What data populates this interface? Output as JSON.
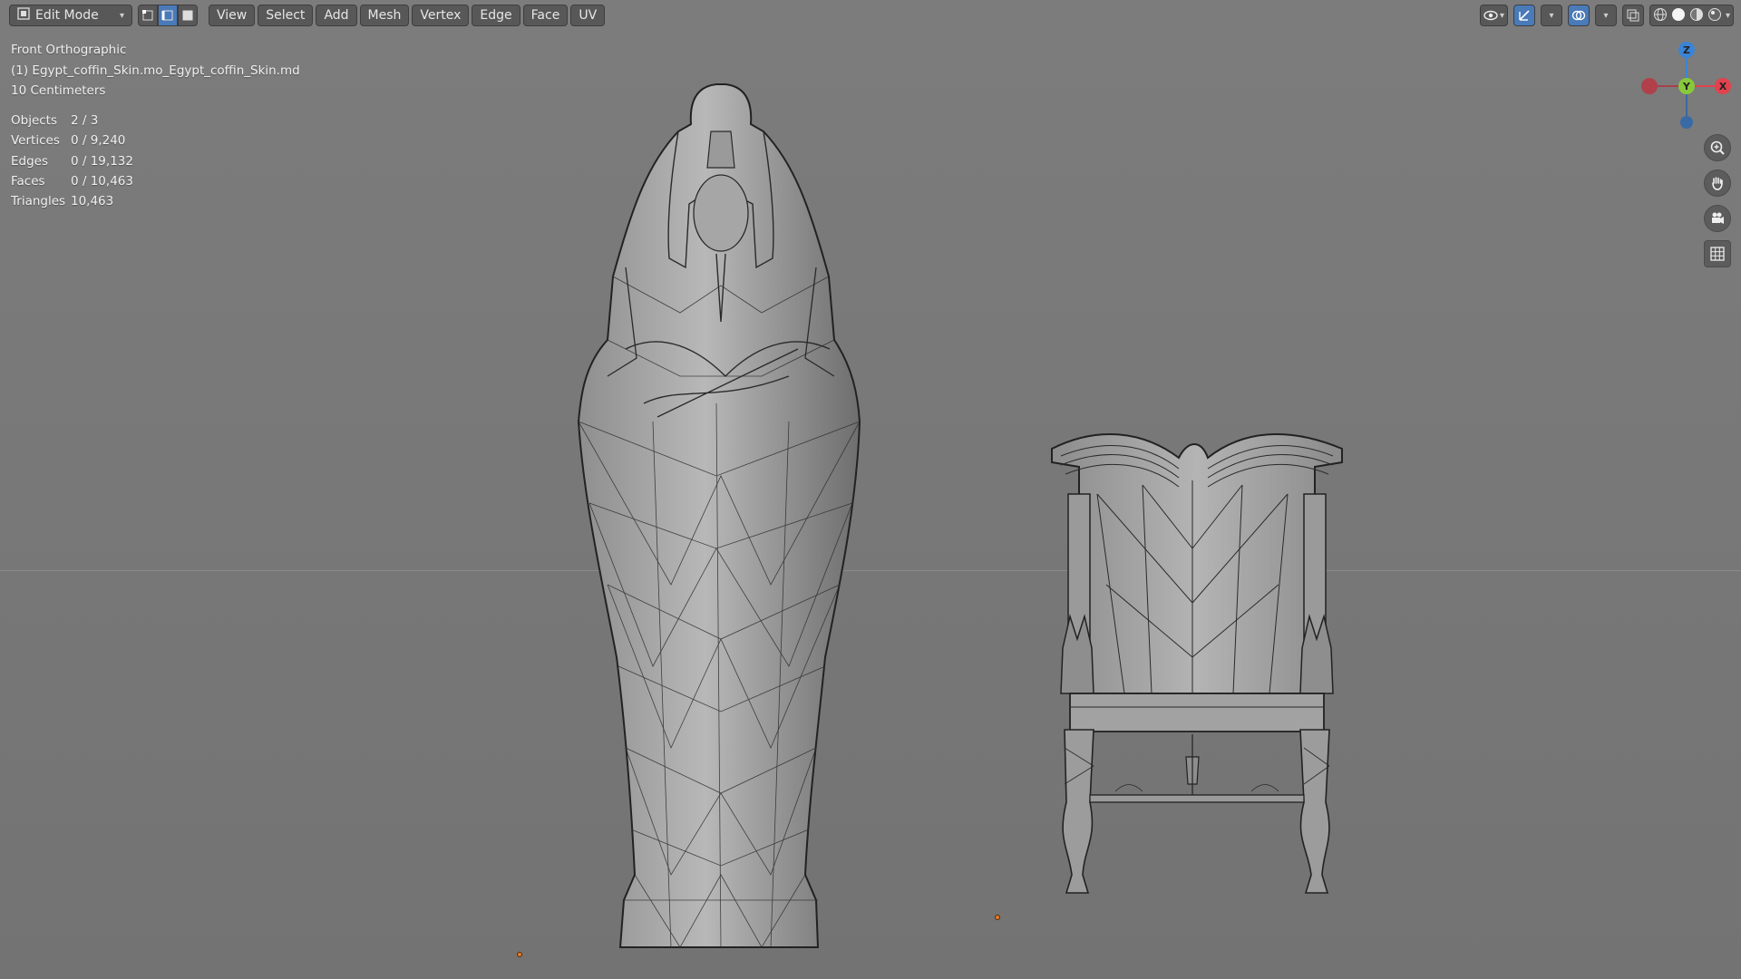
{
  "header": {
    "mode_select": "Edit Mode",
    "menus": [
      "View",
      "Select",
      "Add",
      "Mesh",
      "Vertex",
      "Edge",
      "Face",
      "UV"
    ]
  },
  "overlay": {
    "view_name": "Front Orthographic",
    "object_name": "(1) Egypt_coffin_Skin.mo_Egypt_coffin_Skin.md",
    "scale": "10 Centimeters"
  },
  "stats": [
    {
      "label": "Objects",
      "value": "2 / 3"
    },
    {
      "label": "Vertices",
      "value": "0 / 9,240"
    },
    {
      "label": "Edges",
      "value": "0 / 19,132"
    },
    {
      "label": "Faces",
      "value": "0 / 10,463"
    },
    {
      "label": "Triangles",
      "value": "10,463"
    }
  ],
  "gizmo": {
    "z": "Z",
    "y": "Y",
    "x": "X",
    "colors": {
      "x": "#e2424e",
      "y": "#88c93a",
      "z": "#3a84d6"
    }
  },
  "icons": {
    "select_mode": [
      "vertex-select-icon",
      "edge-select-icon",
      "face-select-icon"
    ],
    "header_right": [
      "visibility-icon",
      "gizmo-icon",
      "overlay-icon",
      "xray-icon",
      "wireframe-shading-icon",
      "solid-shading-icon",
      "material-shading-icon",
      "rendered-shading-icon"
    ],
    "nav": [
      "zoom-icon",
      "pan-hand-icon",
      "camera-icon",
      "ortho-grid-icon"
    ]
  }
}
